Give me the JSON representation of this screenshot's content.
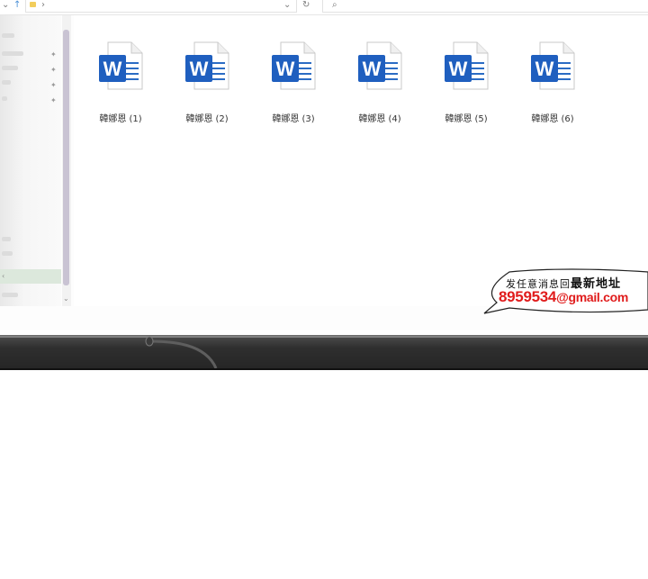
{
  "toolbar": {
    "nav_down_glyph": "⌄",
    "nav_up_glyph": "↑",
    "breadcrumb_chevron": "›",
    "dropdown_glyph": "⌄",
    "refresh_glyph": "↻",
    "search_glyph": "⌕"
  },
  "sidebar": {
    "collapse_glyph": "‹",
    "scroll_down_glyph": "⌄"
  },
  "files": [
    {
      "name": "韓娜恩 (1)"
    },
    {
      "name": "韓娜恩 (2)"
    },
    {
      "name": "韓娜恩 (3)"
    },
    {
      "name": "韓娜恩 (4)"
    },
    {
      "name": "韓娜恩 (5)"
    },
    {
      "name": "韓娜恩 (6)"
    }
  ],
  "file_icon": {
    "name": "word-document-icon",
    "letter": "W",
    "color": "#1f5fbf"
  },
  "promo": {
    "line1": "发任意消息回",
    "line1_bold": "最新地址",
    "line2_number": "8959534",
    "line2_domain": "@gmail.com",
    "text_color": "#e01c1c"
  }
}
